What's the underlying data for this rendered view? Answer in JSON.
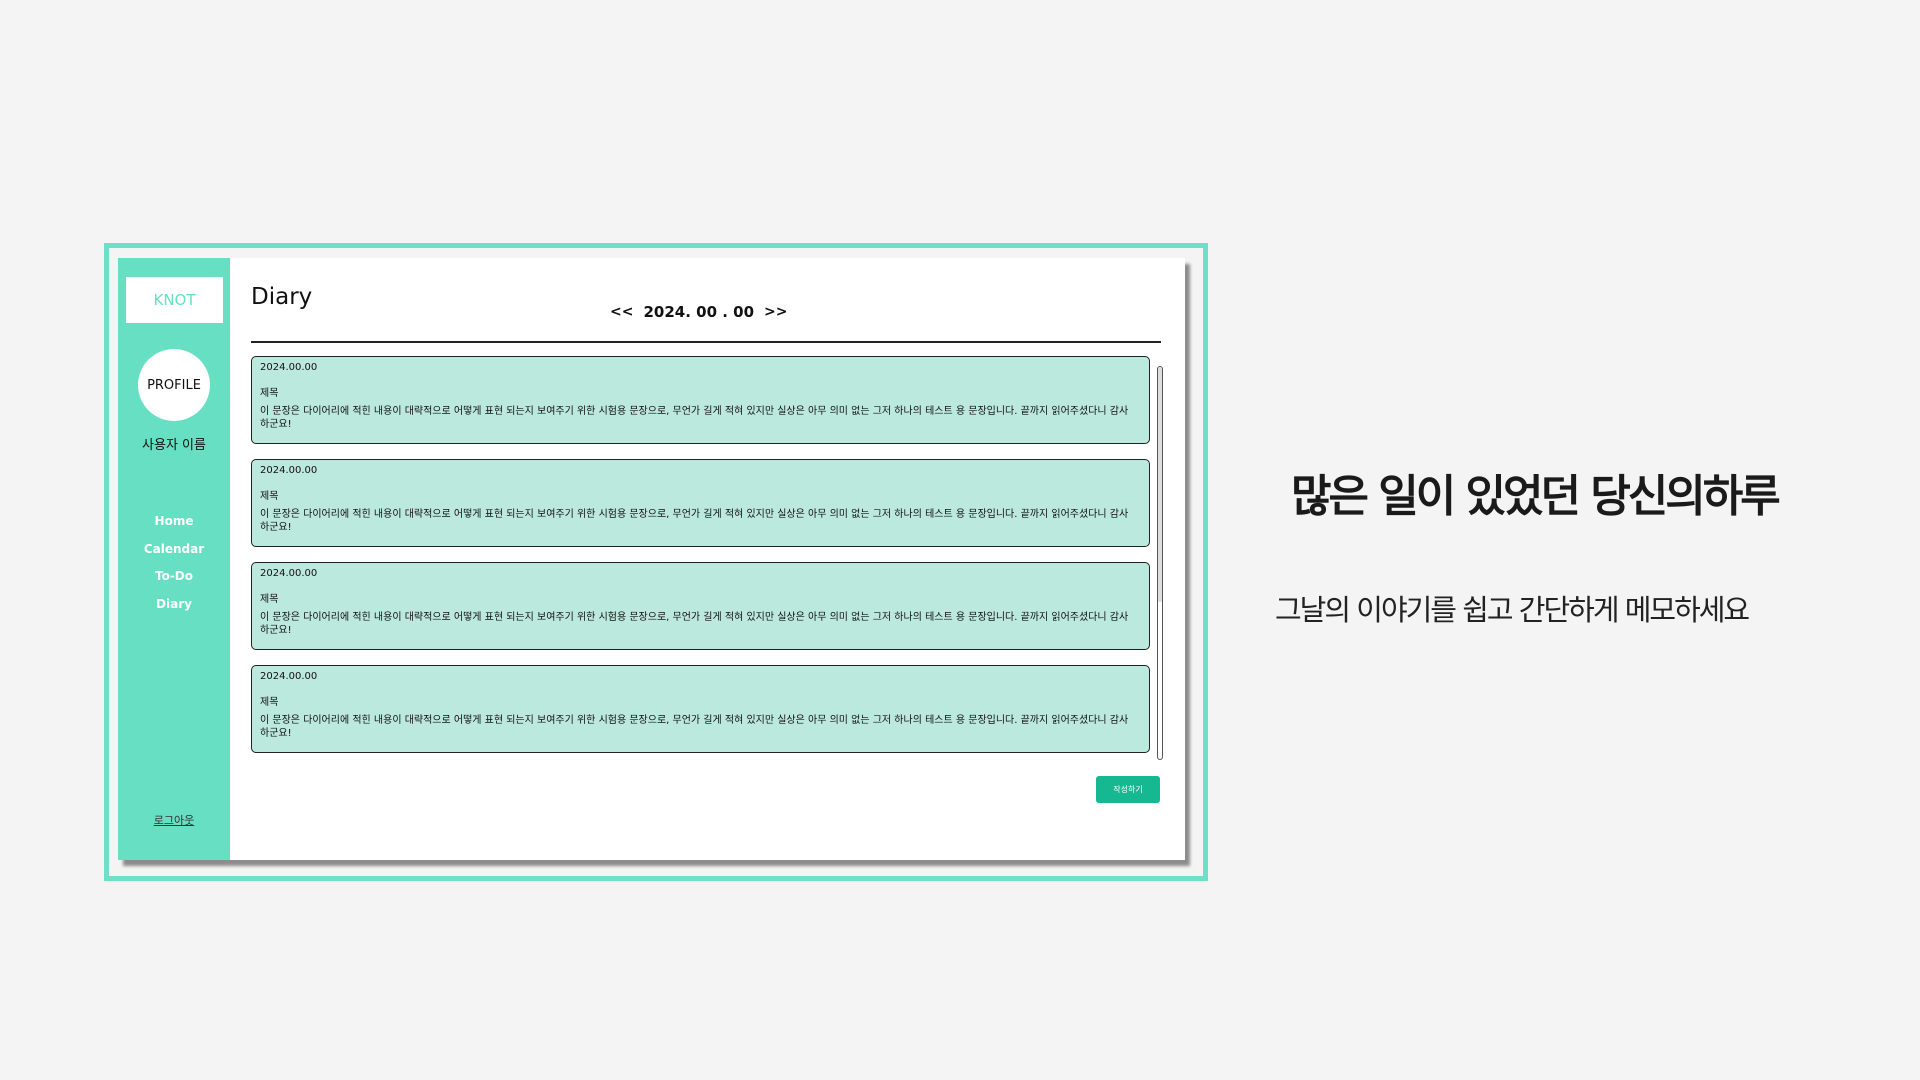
{
  "app": {
    "logo": "KNOT",
    "profile_label": "PROFILE",
    "username": "사용자 이름",
    "nav": [
      "Home",
      "Calendar",
      "To-Do",
      "Diary"
    ],
    "logout": "로그아웃"
  },
  "main": {
    "title": "Diary",
    "date_prev": "<<",
    "date": "2024. 00 . 00",
    "date_next": ">>",
    "entries": [
      {
        "date": "2024.00.00",
        "title": "제목",
        "body": "이 문장은 다이어리에 적힌 내용이 대략적으로 어떻게 표현 되는지 보여주기 위한 시험용 문장으로, 무언가 길게 적혀 있지만 실상은 아무 의미 없는 그저 하나의 테스트 용 문장입니다. 끝까지 읽어주셨다니 감사하군요!"
      },
      {
        "date": "2024.00.00",
        "title": "제목",
        "body": "이 문장은 다이어리에 적힌 내용이 대략적으로 어떻게 표현 되는지 보여주기 위한 시험용 문장으로, 무언가 길게 적혀 있지만 실상은 아무 의미 없는 그저 하나의 테스트 용 문장입니다. 끝까지 읽어주셨다니 감사하군요!"
      },
      {
        "date": "2024.00.00",
        "title": "제목",
        "body": "이 문장은 다이어리에 적힌 내용이 대략적으로 어떻게 표현 되는지 보여주기 위한 시험용 문장으로, 무언가 길게 적혀 있지만 실상은 아무 의미 없는 그저 하나의 테스트 용 문장입니다. 끝까지 읽어주셨다니 감사하군요!"
      },
      {
        "date": "2024.00.00",
        "title": "제목",
        "body": "이 문장은 다이어리에 적힌 내용이 대략적으로 어떻게 표현 되는지 보여주기 위한 시험용 문장으로, 무언가 길게 적혀 있지만 실상은 아무 의미 없는 그저 하나의 테스트 용 문장입니다. 끝까지 읽어주셨다니 감사하군요!"
      }
    ],
    "write_button": "작성하기"
  },
  "promo": {
    "headline": "많은 일이 있었던 당신의하루",
    "subline": "그날의 이야기를 쉽고 간단하게 메모하세요"
  },
  "colors": {
    "accent": "#66dfc2",
    "frame_border": "#6fe0c8",
    "card_bg": "#bce9dd",
    "button": "#15b890",
    "page_bg": "#f4f4f4"
  }
}
